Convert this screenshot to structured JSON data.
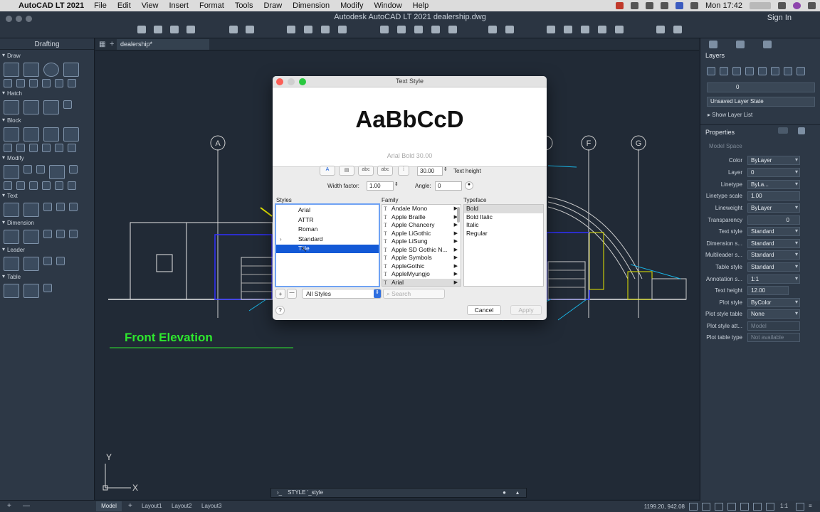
{
  "menubar": {
    "app_name": "AutoCAD LT 2021",
    "items": [
      "File",
      "Edit",
      "View",
      "Insert",
      "Format",
      "Tools",
      "Draw",
      "Dimension",
      "Modify",
      "Window",
      "Help"
    ],
    "clock": "Mon 17:42"
  },
  "window": {
    "title": "Autodesk AutoCAD LT 2021   dealership.dwg",
    "sign_in": "Sign In"
  },
  "left_palette": {
    "title": "Drafting",
    "sections": [
      "Draw",
      "Hatch",
      "Block",
      "Modify",
      "Text",
      "Dimension",
      "Leader",
      "Table"
    ]
  },
  "tabs": {
    "file_tab": "dealership*"
  },
  "canvas": {
    "drawing_label": "Front Elevation",
    "grid_bubbles": [
      "A",
      "F",
      "G"
    ],
    "axis_y": "Y",
    "axis_x": "X"
  },
  "command_line": {
    "text": "STYLE '_style"
  },
  "status_bar": {
    "tabs": [
      "Model",
      "Layout1",
      "Layout2",
      "Layout3"
    ],
    "coords": "1199.20, 942.08",
    "scale": "1:1"
  },
  "layers_panel": {
    "title": "Layers",
    "layer_value": "0",
    "layer_state": "Unsaved Layer State",
    "show_layer_list": "Show Layer List"
  },
  "properties_panel": {
    "title": "Properties",
    "space": "Model Space",
    "rows": [
      {
        "label": "Color",
        "value": "ByLayer"
      },
      {
        "label": "Layer",
        "value": "0"
      },
      {
        "label": "Linetype",
        "value": "ByLa..."
      },
      {
        "label": "Linetype scale",
        "value": "1.00"
      },
      {
        "label": "Lineweight",
        "value": "ByLayer"
      },
      {
        "label": "Transparency",
        "value": "0"
      },
      {
        "label": "Text style",
        "value": "Standard"
      },
      {
        "label": "Dimension s...",
        "value": "Standard"
      },
      {
        "label": "Multileader s...",
        "value": "Standard"
      },
      {
        "label": "Table style",
        "value": "Standard"
      },
      {
        "label": "Annotation s...",
        "value": "1:1"
      },
      {
        "label": "Text height",
        "value": "12.00"
      },
      {
        "label": "Plot style",
        "value": "ByColor"
      },
      {
        "label": "Plot style table",
        "value": "None"
      },
      {
        "label": "Plot style att...",
        "value": "Model"
      },
      {
        "label": "Plot table type",
        "value": "Not available"
      }
    ]
  },
  "dialog": {
    "title": "Text Style",
    "preview_text": "AaBbCcD",
    "preview_info": "Arial   Bold   30.00",
    "text_height_value": "30.00",
    "text_height_label": "Text height",
    "width_factor_label": "Width factor:",
    "width_factor_value": "1.00",
    "angle_label": "Angle:",
    "angle_value": "0",
    "styles_label": "Styles",
    "family_label": "Family",
    "typeface_label": "Typeface",
    "styles": [
      "Arial",
      "ATTR",
      "Roman",
      "Standard",
      "Title"
    ],
    "selected_style": "Title",
    "families": [
      "Andale Mono",
      "Apple Braille",
      "Apple Chancery",
      "Apple LiGothic",
      "Apple LiSung",
      "Apple SD Gothic N...",
      "Apple Symbols",
      "AppleGothic",
      "AppleMyungjo",
      "Arial"
    ],
    "typefaces": [
      "Bold",
      "Bold Italic",
      "Italic",
      "Regular"
    ],
    "filter_value": "All Styles",
    "search_placeholder": "Search",
    "add_label": "+",
    "remove_label": "—",
    "help_label": "?",
    "cancel_label": "Cancel",
    "apply_label": "Apply"
  },
  "colors": {
    "canvas_bg": "#212a36",
    "dialog_selection": "#1359d6",
    "label_green": "#2ee82e"
  }
}
